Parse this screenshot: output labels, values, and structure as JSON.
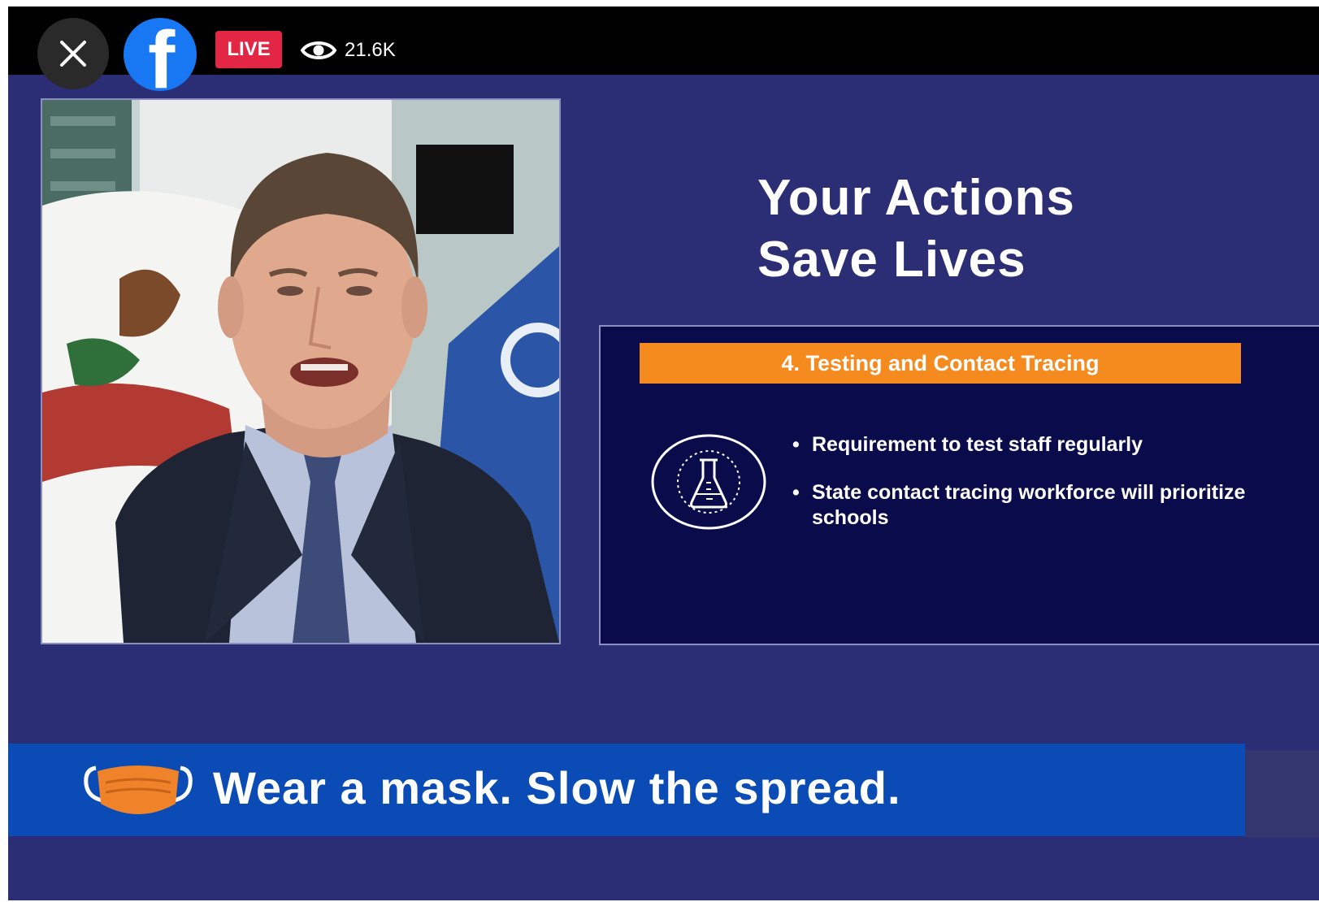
{
  "player": {
    "live_label": "LIVE",
    "viewer_count": "21.6K",
    "close_icon": "close-icon",
    "logo_icon": "facebook-logo",
    "viewer_icon": "eye-icon"
  },
  "slide": {
    "title_line1": "Your Actions",
    "title_line2": "Save Lives",
    "section_heading": "4. Testing and Contact Tracing",
    "section_icon": "flask-icon",
    "bullets": [
      "Requirement to test staff regularly",
      "State contact tracing workforce will prioritize schools"
    ]
  },
  "banner": {
    "text": "Wear a mask. Slow the spread.",
    "icon": "face-mask-icon"
  },
  "colors": {
    "background": "#2b2d75",
    "panel": "#0a0b4a",
    "accent_orange": "#f58a1f",
    "banner_blue": "#0a4bb5",
    "live_red": "#e42645",
    "facebook_blue": "#1877f2"
  }
}
